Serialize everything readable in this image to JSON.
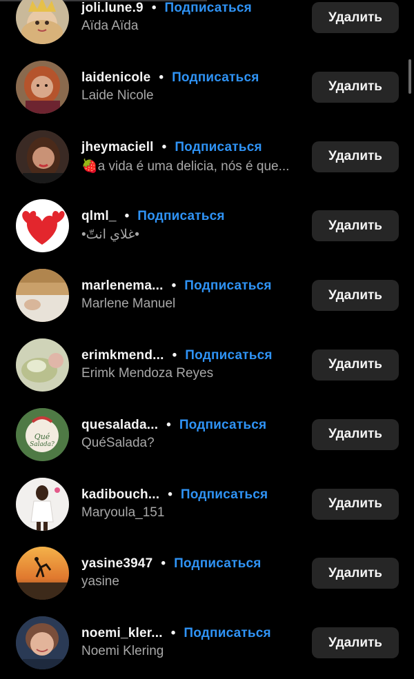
{
  "colors": {
    "background": "#000000",
    "follow_accent": "#2f93f5",
    "button_bg": "#262626",
    "secondary_text": "#a8a8a8"
  },
  "followers": [
    {
      "username": "joli.lune.9",
      "follow_label": "Подписаться",
      "fullname": "Aïda Aïda",
      "delete_label": "Удалить",
      "avatar": "avatar-crown-girl"
    },
    {
      "username": "laidenicole",
      "follow_label": "Подписаться",
      "fullname": "Laide Nicole",
      "delete_label": "Удалить",
      "avatar": "avatar-woman-red-hair"
    },
    {
      "username": "jheymaciell",
      "follow_label": "Подписаться",
      "fullname": "🍓a vida é uma delicia, nós é que...",
      "delete_label": "Удалить",
      "avatar": "avatar-woman-selfie"
    },
    {
      "username": "qlml_",
      "follow_label": "Подписаться",
      "fullname": "•غلاي انتّ•",
      "delete_label": "Удалить",
      "avatar": "avatar-red-hearts"
    },
    {
      "username": "marlenema...",
      "follow_label": "Подписаться",
      "fullname": "Marlene Manuel",
      "delete_label": "Удалить",
      "avatar": "avatar-baby-blanket"
    },
    {
      "username": "erimkmend...",
      "follow_label": "Подписаться",
      "fullname": "Erimk Mendoza Reyes",
      "delete_label": "Удалить",
      "avatar": "avatar-newborn"
    },
    {
      "username": "quesalada...",
      "follow_label": "Подписаться",
      "fullname": "QuéSalada?",
      "delete_label": "Удалить",
      "avatar": "avatar-quesalada-logo"
    },
    {
      "username": "kadibouch...",
      "follow_label": "Подписаться",
      "fullname": "Maryoula_151",
      "delete_label": "Удалить",
      "avatar": "avatar-woman-white-outfit"
    },
    {
      "username": "yasine3947",
      "follow_label": "Подписаться",
      "fullname": "yasine",
      "delete_label": "Удалить",
      "avatar": "avatar-sunset-silhouette"
    },
    {
      "username": "noemi_kler...",
      "follow_label": "Подписаться",
      "fullname": "Noemi Klering",
      "delete_label": "Удалить",
      "avatar": "avatar-woman-smiling"
    }
  ]
}
